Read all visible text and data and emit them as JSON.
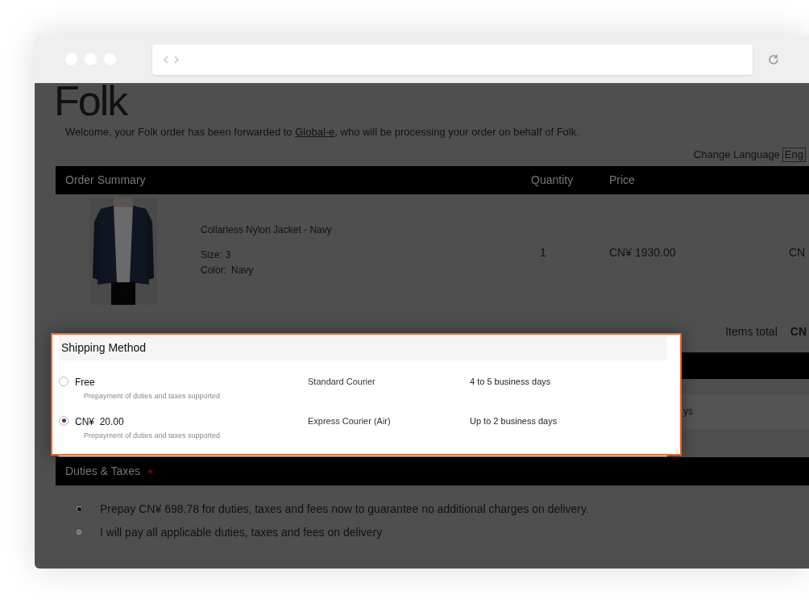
{
  "logo": "Folk",
  "welcome": {
    "before": "Welcome, your Folk order has been forwarded to ",
    "link": "Global-e",
    "after": ", who will be processing your order on behalf of Folk."
  },
  "language": {
    "label": "Change Language",
    "value": "Eng"
  },
  "order_summary": {
    "columns": [
      "Order Summary",
      "Quantity",
      "Price"
    ],
    "items": [
      {
        "name": "Collarless Nylon Jacket - Navy",
        "size_label": "Size:",
        "size": "3",
        "color_label": "Color:",
        "color_value": "Navy",
        "quantity": "1",
        "price": "CN¥ 1930.00",
        "column_4": "CN"
      }
    ],
    "items_total": {
      "label": "Items total",
      "value": "CN"
    }
  },
  "covered_row_text": "ys",
  "shipping_method": {
    "title": "Shipping Method",
    "options": [
      {
        "price": "Free",
        "note": "Prepayment of duties and taxes supported",
        "service": "Standard Courier",
        "delivery": "4 to 5 business days",
        "selected": false
      },
      {
        "price": "CN¥  20.00",
        "note": "Prepayment of duties and taxes supported",
        "service": "Express Courier (Air)",
        "delivery": "Up to 2 business days",
        "selected": true
      }
    ]
  },
  "duties": {
    "title": "Duties & Taxes",
    "required": true,
    "required_mark": "★",
    "options": [
      {
        "label": "Prepay CN¥ 698.78 for duties, taxes and fees now to guarantee no additional charges on delivery.",
        "selected": true
      },
      {
        "label": "I will pay all applicable duties, taxes and fees on delivery",
        "selected": false
      }
    ]
  }
}
